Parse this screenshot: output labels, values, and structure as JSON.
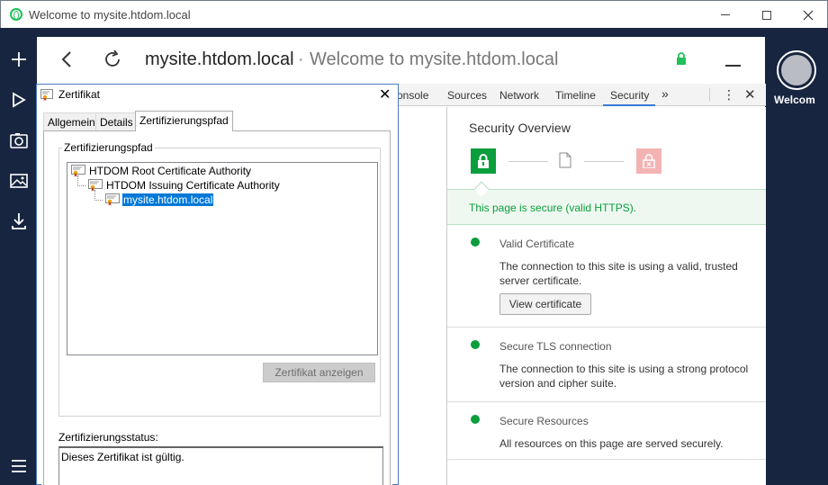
{
  "window": {
    "title": "Welcome to mysite.htdom.local"
  },
  "addressbar": {
    "host": "mysite.htdom.local",
    "separator": "·",
    "page_title": "Welcome to mysite.htdom.local"
  },
  "sidebar": {
    "items": [
      {
        "icon": "plus-icon"
      },
      {
        "icon": "play-icon"
      },
      {
        "icon": "camera-icon"
      },
      {
        "icon": "image-icon"
      },
      {
        "icon": "download-icon"
      },
      {
        "icon": "hamburger-menu-icon"
      }
    ]
  },
  "right_panel": {
    "label": "Welcom"
  },
  "devtools": {
    "tabs": [
      "onsole",
      "Sources",
      "Network",
      "Timeline",
      "Security"
    ],
    "active_tab": "Security",
    "more": "»",
    "dots": "⋮",
    "close": "✕",
    "security": {
      "title": "Security Overview",
      "banner": "This page is secure (valid HTTPS).",
      "items": [
        {
          "title": "Valid Certificate",
          "desc": "The connection to this site is using a valid, trusted server certificate.",
          "button": "View certificate"
        },
        {
          "title": "Secure TLS connection",
          "desc": "The connection to this site is using a strong protocol version and cipher suite."
        },
        {
          "title": "Secure Resources",
          "desc": "All resources on this page are served securely."
        }
      ],
      "colors": {
        "secure": "#0b9e3c",
        "insecure": "#f4b3b3",
        "tab_underline": "#3879d9"
      }
    }
  },
  "dialog": {
    "title": "Zertifikat",
    "close": "✕",
    "tabs": [
      "Allgemein",
      "Details",
      "Zertifizierungspfad"
    ],
    "active_tab": "Zertifizierungspfad",
    "group_label": "Zertifizierungspfad",
    "tree": [
      {
        "label": "HTDOM Root Certificate Authority",
        "level": 0
      },
      {
        "label": "HTDOM Issuing Certificate Authority",
        "level": 1
      },
      {
        "label": "mysite.htdom.local",
        "level": 2,
        "selected": true
      }
    ],
    "show_cert_button": "Zertifikat anzeigen",
    "status_label": "Zertifizierungsstatus:",
    "status_text": "Dieses Zertifikat ist gültig."
  }
}
